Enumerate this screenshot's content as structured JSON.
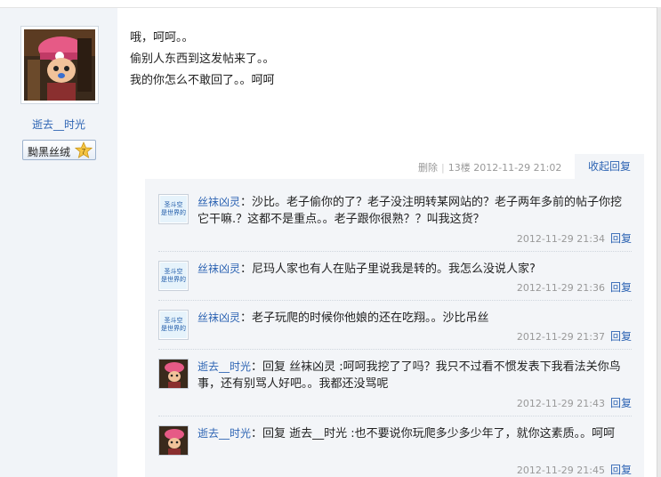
{
  "post": {
    "author": "逝去__时光",
    "badge": {
      "name": "黝黑丝绒",
      "level": "7"
    },
    "lines": [
      "哦，呵呵。。",
      "偷别人东西到这发帖来了。。",
      "我的你怎么不敢回了。。呵呵"
    ],
    "meta": {
      "delete_label": "删除",
      "separator": "|",
      "floor": "13楼",
      "time": "2012-11-29 21:02"
    },
    "collapse_label": "收起回复"
  },
  "replies": [
    {
      "user": "丝袜凶灵",
      "avatar_text": "是世界的",
      "avatar_top": "圣斗空",
      "text": "：沙比。老子偷你的了？老子没注明转某网站的？老子两年多前的帖子你挖它干嘛.？这都不是重点。。老子跟你很熟？？叫我这货？",
      "time": "2012-11-29 21:34",
      "reply_label": "回复"
    },
    {
      "user": "丝袜凶灵",
      "avatar_text": "是世界的",
      "avatar_top": "圣斗空",
      "text": "：尼玛人家也有人在贴子里说我是转的。我怎么没说人家?",
      "time": "2012-11-29 21:36",
      "reply_label": "回复"
    },
    {
      "user": "丝袜凶灵",
      "avatar_text": "是世界的",
      "avatar_top": "圣斗空",
      "text": "：老子玩爬的时候你他娘的还在吃翔。。沙比吊丝",
      "time": "2012-11-29 21:37",
      "reply_label": "回复"
    },
    {
      "user": "逝去__时光",
      "text": "：回复 丝袜凶灵 :呵呵我挖了了吗？我只不过看不惯发表下我看法关你鸟事，还有别骂人好吧。。我都还没骂呢",
      "time": "2012-11-29 21:43",
      "reply_label": "回复"
    },
    {
      "user": "逝去__时光",
      "text": "：回复 逝去__时光 :也不要说你玩爬多少多少年了，就你这素质。。呵呵",
      "time": "2012-11-29 21:45",
      "reply_label": "回复"
    }
  ],
  "colors": {
    "link": "#2d64b3",
    "sidebar": "#f1f4f8",
    "reply_bg": "#f3f5f8"
  }
}
